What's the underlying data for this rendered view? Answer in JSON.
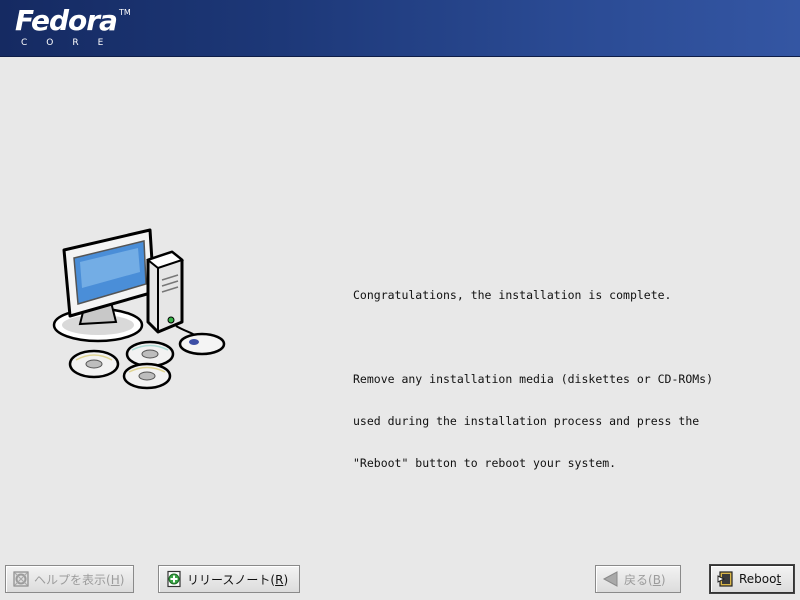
{
  "header": {
    "logo_word": "Fedora",
    "logo_tm": "TM",
    "logo_sub": "CORE"
  },
  "message": {
    "line1": "Congratulations, the installation is complete.",
    "line2": "Remove any installation media (diskettes or CD-ROMs)",
    "line3": "used during the installation process and press the",
    "line4": "\"Reboot\" button to reboot your system."
  },
  "buttons": {
    "help": {
      "label": "ヘルプを表示(",
      "mnemonic": "H",
      "tail": ")",
      "icon": "help-icon",
      "enabled": false
    },
    "release_notes": {
      "label": "リリースノート(",
      "mnemonic": "R",
      "tail": ")",
      "icon": "release-notes-icon",
      "enabled": true
    },
    "back": {
      "label": "戻る(",
      "mnemonic": "B",
      "tail": ")",
      "icon": "back-arrow-icon",
      "enabled": false
    },
    "reboot": {
      "label": "Reboo",
      "mnemonic": "t",
      "tail": "",
      "icon": "reboot-icon",
      "enabled": true
    }
  },
  "colors": {
    "header_dark": "#152a62",
    "header_light": "#3456a3",
    "background": "#e8e8e8",
    "monitor_screen": "#4a8ed8"
  }
}
